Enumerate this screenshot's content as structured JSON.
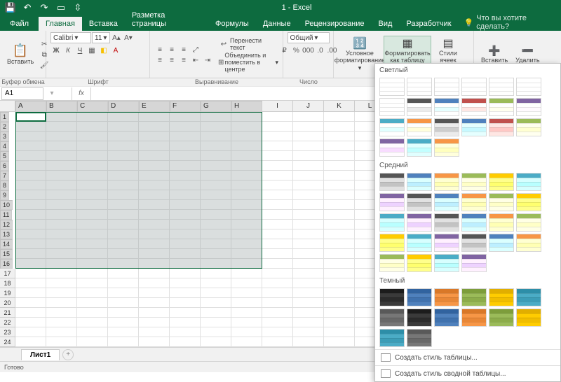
{
  "title": "1 - Excel",
  "qat": [
    "save",
    "undo",
    "redo",
    "form",
    "touch"
  ],
  "tabs": {
    "file": "Файл",
    "items": [
      "Главная",
      "Вставка",
      "Разметка страницы",
      "Формулы",
      "Данные",
      "Рецензирование",
      "Вид",
      "Разработчик"
    ],
    "active": 0,
    "help": "Что вы хотите сделать?"
  },
  "ribbon": {
    "clipboard": {
      "paste": "Вставить",
      "label": "Буфер обмена"
    },
    "font": {
      "name": "Calibri",
      "size": "11",
      "label": "Шрифт"
    },
    "align": {
      "wrap": "Перенести текст",
      "merge": "Объединить и поместить в центре",
      "label": "Выравнивание"
    },
    "number": {
      "format": "Общий",
      "label": "Число"
    },
    "styles": {
      "cond": "Условное форматирование",
      "table": "Форматировать как таблицу",
      "cell": "Стили ячеек"
    },
    "cells": {
      "insert": "Вставить",
      "delete": "Удалить"
    }
  },
  "namebox": "A1",
  "columns": [
    "A",
    "B",
    "C",
    "D",
    "E",
    "F",
    "G",
    "H",
    "I",
    "J",
    "K",
    "L"
  ],
  "selCols": 8,
  "selRows": 16,
  "sheet": "Лист1",
  "status": "Готово",
  "gallery": {
    "light": "Светлый",
    "medium": "Средний",
    "dark": "Темный",
    "lightColors": [
      "#555",
      "#4f81bd",
      "#c0504d",
      "#9bbb59",
      "#8064a2",
      "#4bacc6",
      "#f79646"
    ],
    "mediumColors": [
      "#555",
      "#4f81bd",
      "#f79646",
      "#9bbb59",
      "#ffcc00",
      "#4bacc6",
      "#8064a2"
    ],
    "darkColors": [
      "#3a3a3a",
      "#4f81bd",
      "#f79646",
      "#9bbb59",
      "#ffcc00",
      "#4bacc6",
      "#777"
    ],
    "newStyle": "Создать стиль таблицы...",
    "newPivot": "Создать стиль сводной таблицы..."
  }
}
